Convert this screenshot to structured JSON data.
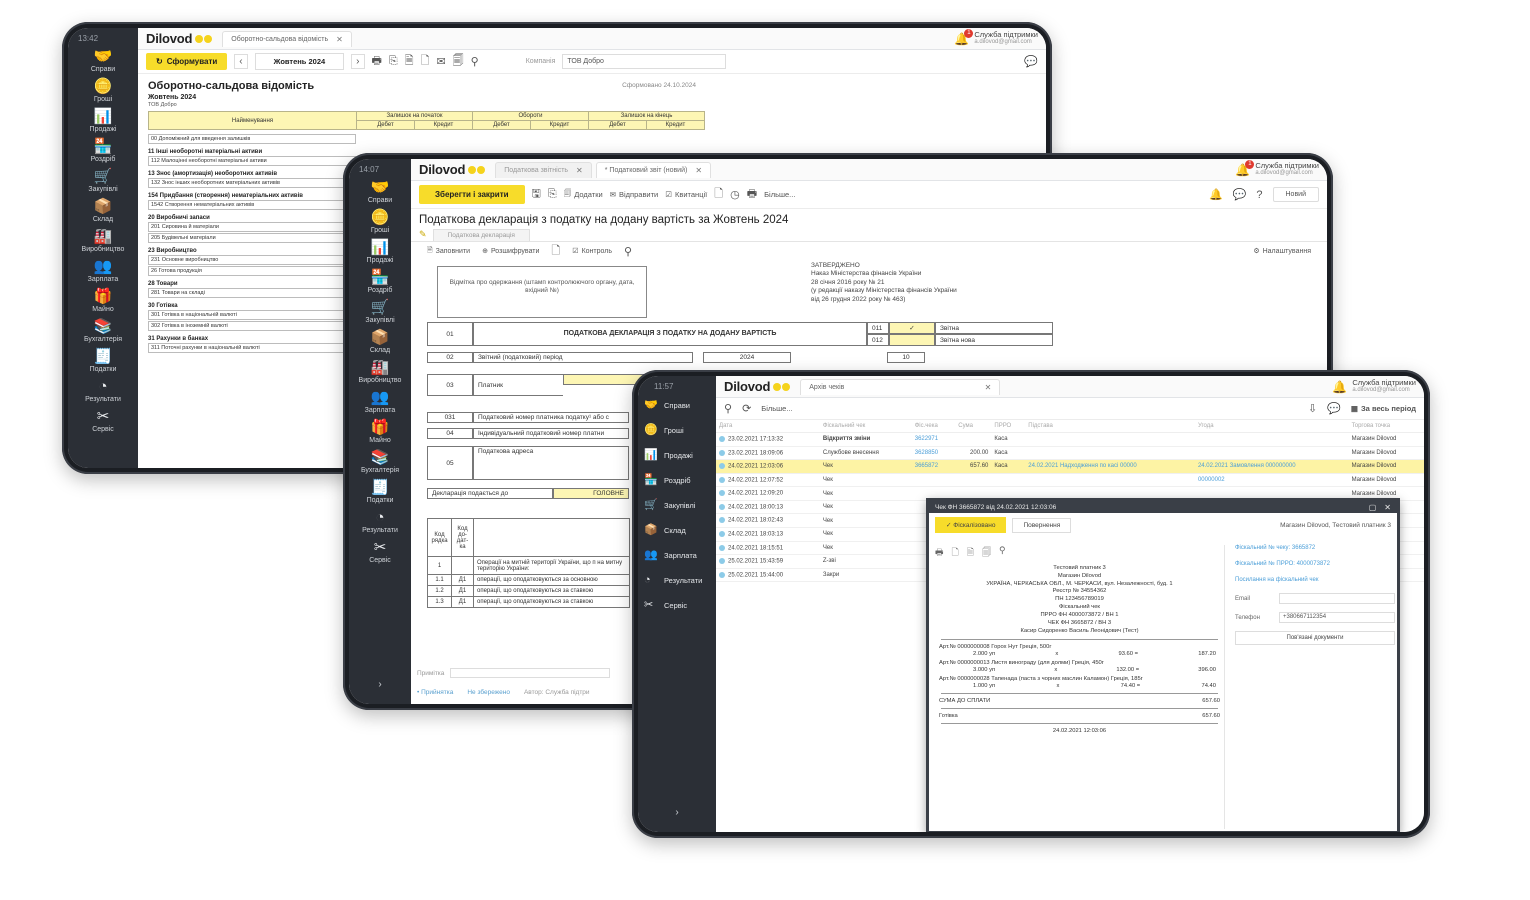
{
  "sidebar_items": [
    {
      "label": "Справи",
      "icon": "handshake-icon",
      "glyph": "🤝"
    },
    {
      "label": "Гроші",
      "icon": "coins-icon",
      "glyph": "🪙"
    },
    {
      "label": "Продажі",
      "icon": "chart-icon",
      "glyph": "📊"
    },
    {
      "label": "Роздріб",
      "icon": "register-icon",
      "glyph": "🏪"
    },
    {
      "label": "Закупівлі",
      "icon": "cart-icon",
      "glyph": "🛒"
    },
    {
      "label": "Склад",
      "icon": "boxes-icon",
      "glyph": "📦"
    },
    {
      "label": "Виробництво",
      "icon": "factory-icon",
      "glyph": "🏭"
    },
    {
      "label": "Зарплата",
      "icon": "people-icon",
      "glyph": "👥"
    },
    {
      "label": "Майно",
      "icon": "hand-box-icon",
      "glyph": "🎁"
    },
    {
      "label": "Бухгалтерія",
      "icon": "books-icon",
      "glyph": "📚"
    },
    {
      "label": "Податки",
      "icon": "stamp-icon",
      "glyph": "🧾"
    },
    {
      "label": "Результати",
      "icon": "pie-icon",
      "glyph": "◔"
    },
    {
      "label": "Сервіс",
      "icon": "tools-icon",
      "glyph": "✂"
    }
  ],
  "sidebar3_items": [
    {
      "label": "Справи"
    },
    {
      "label": "Гроші"
    },
    {
      "label": "Продажі"
    },
    {
      "label": "Роздріб"
    },
    {
      "label": "Закупівлі"
    },
    {
      "label": "Склад"
    },
    {
      "label": "Зарплата"
    },
    {
      "label": "Результати"
    },
    {
      "label": "Сервіс"
    }
  ],
  "common": {
    "logo": "Dilovod",
    "support_name": "Служба підтримки",
    "support_mail": "a.dilovod@gmail.com",
    "bell_count": "1"
  },
  "t1": {
    "time": "13:42",
    "tab": "Оборотно-сальдова відомість",
    "btn_form": "Сформувати",
    "period": "Жовтень 2024",
    "company_label": "Компанія",
    "company_value": "ТОВ Добро",
    "report_title": "Оборотно-сальдова відомість",
    "report_sub": "Жовтень 2024",
    "report_org": "ТОВ Добро",
    "formed": "Сформовано 24.10.2024",
    "headers": {
      "name": "Найменування",
      "start": "Залишок на початок",
      "turnover": "Обороти",
      "end": "Залишок на кінець",
      "debit": "Дебет",
      "credit": "Кредит"
    },
    "rows": [
      {
        "group": "",
        "items": [
          "00 Допоміжний для введення залишків"
        ]
      },
      {
        "group": "11 Інші необоротні матеріальні активи",
        "items": [
          "112 Малоцінні необоротні матеріальні активи"
        ]
      },
      {
        "group": "13 Знос (амортизація) необоротних активів",
        "items": [
          "132 Знос інших необоротних матеріальних активів"
        ]
      },
      {
        "group": "154 Придбання (створення) нематеріальних активів",
        "items": [
          "1542 Створення нематеріальних активів"
        ]
      },
      {
        "group": "20 Виробничі запаси",
        "items": [
          "201 Сировина й матеріали",
          "205 Будівельні матеріали"
        ]
      },
      {
        "group": "23 Виробництво",
        "items": [
          "231 Основне виробництво"
        ]
      },
      {
        "group": "",
        "items": [
          "26 Готова продукція"
        ]
      },
      {
        "group": "28 Товари",
        "items": [
          "281 Товари на складі"
        ]
      },
      {
        "group": "30 Готівка",
        "items": [
          "301 Готівка в національній валюті",
          "302 Готівка в іноземній валюті"
        ]
      },
      {
        "group": "31 Рахунки в банках",
        "items": [
          "311 Поточні рахунки в національній валюті"
        ]
      }
    ]
  },
  "t2": {
    "time": "14:07",
    "tab1": "Податкова звітність",
    "tab2": "* Податковий звіт (новий)",
    "btn_save": "Зберегти і закрити",
    "btn_attach": "Додатки",
    "btn_send": "Відправити",
    "btn_receipts": "Квитанції",
    "btn_more": "Більше...",
    "btn_new": "Новий",
    "doc_title": "Податкова декларація з податку на додану вартість за Жовтень 2024",
    "subtab": "Податкова декларація",
    "fill": "Заповнити",
    "decrypt": "Розшифрувати",
    "control": "Контроль",
    "settings": "Налаштування",
    "stamp_text": "Відмітка про одержання (штамп контролюючого органу, дата, вхідний №)",
    "approved": [
      "ЗАТВЕРДЖЕНО",
      "Наказ Міністерства фінансів України",
      "28 січня 2016 року № 21",
      "(у редакції наказу Міністерства фінансів України",
      "від 26 грудня 2022 року № 463)"
    ],
    "row01": "01",
    "decl_title": "ПОДАТКОВА ДЕКЛАРАЦІЯ З ПОДАТКУ НА ДОДАНУ ВАРТІСТЬ",
    "code011": "011",
    "code012": "012",
    "check": "✓",
    "report": "Звітна",
    "report_new": "Звітна нова",
    "row02": "02",
    "period_label": "Звітний (податковий) період",
    "year": "2024",
    "month": "10",
    "row03": "03",
    "payer": "Платник",
    "row031": "031",
    "tax_no": "Податковий номер платника податку¹ або с",
    "row04": "04",
    "ipn": "Індивідуальний податковий номер платни",
    "row05": "05",
    "address": "Податкова адреса",
    "submitted_to": "Декларація подається до",
    "main_office": "ГОЛОВНЕ",
    "code_row": "Код рядка",
    "code_dt": "Код до-дат-ка",
    "ops1": "Операції на митній території України, що п на митну територію України:",
    "ops2": "операції, що оподатковуються за основною",
    "ops3": "операції, що оподатковуються за ставкою",
    "ops4": "операції, що оподатковуються за ставкою",
    "r1": "1",
    "r11": "1.1",
    "r12": "1.2",
    "r13": "1.3",
    "d1": "Д1",
    "note": "Примітка",
    "s_accept": "• Прийнятка",
    "s_saved": "Не збережено",
    "s_author": "Автор: Служба підтри"
  },
  "t3": {
    "time": "11:57",
    "tab": "Архів чеків",
    "more": "Більше...",
    "period": "За весь період",
    "cols": [
      "Дата",
      "Фіскальний чек",
      "Фіс.чека",
      "Сума",
      "ПРРО",
      "Підстава",
      "Угода",
      "Торгова точка"
    ],
    "rows": [
      {
        "date": "23.02.2021 17:13:32",
        "type": "Відкриття зміни",
        "num": "3622971",
        "sum": "",
        "prro": "Каса",
        "base": "",
        "deal": "",
        "shop": "Магазин Dilovod",
        "bold": true
      },
      {
        "date": "23.02.2021 18:09:06",
        "type": "Службове внесення",
        "num": "3628850",
        "sum": "200.00",
        "prro": "Каса",
        "base": "",
        "deal": "",
        "shop": "Магазин Dilovod"
      },
      {
        "date": "24.02.2021 12:03:06",
        "type": "Чек",
        "num": "3665872",
        "sum": "657.60",
        "prro": "Каса",
        "base": "24.02.2021 Надходження по касі 00000",
        "deal": "24.02.2021 Замовлення 000000000",
        "shop": "Магазин Dilovod",
        "sel": true
      },
      {
        "date": "24.02.2021 12:07:52",
        "type": "Чек",
        "num": "",
        "sum": "",
        "prro": "",
        "base": "",
        "deal": "00000002",
        "shop": "Магазин Dilovod"
      },
      {
        "date": "24.02.2021 12:09:20",
        "type": "Чек",
        "num": "",
        "sum": "",
        "prro": "",
        "base": "",
        "deal": "",
        "shop": "Магазин Dilovod"
      },
      {
        "date": "24.02.2021 18:00:13",
        "type": "Чек",
        "num": "",
        "sum": "",
        "prro": "",
        "base": "",
        "deal": "",
        "shop": "Магазин Dilovod"
      },
      {
        "date": "24.02.2021 18:02:43",
        "type": "Чек",
        "num": "",
        "sum": "",
        "prro": "",
        "base": "",
        "deal": "",
        "shop": "Магазин Dilovod"
      },
      {
        "date": "24.02.2021 18:03:13",
        "type": "Чек",
        "num": "",
        "sum": "",
        "prro": "",
        "base": "",
        "deal": "",
        "shop": "Магазин Dilovod"
      },
      {
        "date": "24.02.2021 18:15:51",
        "type": "Чек",
        "num": "",
        "sum": "",
        "prro": "",
        "base": "",
        "deal": "",
        "shop": "Магазин Dilovod"
      },
      {
        "date": "25.02.2021 15:43:59",
        "type": "Z-зві",
        "num": "",
        "sum": "",
        "prro": "",
        "base": "",
        "deal": "",
        "shop": "Магазин Dilovod"
      },
      {
        "date": "25.02.2021 15:44:00",
        "type": "Закри",
        "num": "",
        "sum": "",
        "prro": "",
        "base": "",
        "deal": "",
        "shop": "Магазин Dilovod"
      }
    ],
    "modal": {
      "title": "Чек ФН 3665872 від 24.02.2021 12:03:06",
      "tab_fiscal": "Фіскалізовано",
      "tab_return": "Повернення",
      "shop": "Магазин Dilovod, Тестовий платник 3",
      "receipt_head": [
        "Тестовий платник 3",
        "Магазин Dilovod",
        "УКРАЇНА, ЧЕРКАСЬКА ОБЛ., М. ЧЕРКАСИ, вул. Незалежності, буд. 1",
        "Реєстр № 34554362",
        "ПН 123456789019",
        "Фіскальний чек",
        "ПРРО ФН 4000073872 / ВН 1",
        "ЧЕК ФН 3665872 / ВН 3",
        "Касир Сидоренко Василь Леонідович (Тест)"
      ],
      "items": [
        {
          "name": "Арт.№ 0000000008 Горох Нут Греція, 500г",
          "qty": "2.000 уп",
          "x": "x",
          "price": "93.60 =",
          "sum": "187.20"
        },
        {
          "name": "Арт.№ 0000000013 Листя винограду (для долми) Греція, 450г",
          "qty": "3.000 уп",
          "x": "x",
          "price": "132.00 =",
          "sum": "396.00"
        },
        {
          "name": "Арт.№ 0000000028 Тапенада (паста з чорних маслин Каламон) Греція, 185г",
          "qty": "1.000 уп",
          "x": "x",
          "price": "74.40 =",
          "sum": "74.40"
        }
      ],
      "total_label": "СУМА ДО СПЛАТИ",
      "total": "657.60",
      "cash_label": "Готівка",
      "cash": "657.60",
      "footer_date": "24.02.2021 12:03:06",
      "link1": "Фіскальний № чеку: 3665872",
      "link2": "Фіскальний № ПРРО: 4000073872",
      "link3": "Посилання на фіскальний чек",
      "email_label": "Email",
      "phone_label": "Телефон",
      "phone_value": "+380667112354",
      "btn_docs": "Пов'язані документи"
    }
  }
}
